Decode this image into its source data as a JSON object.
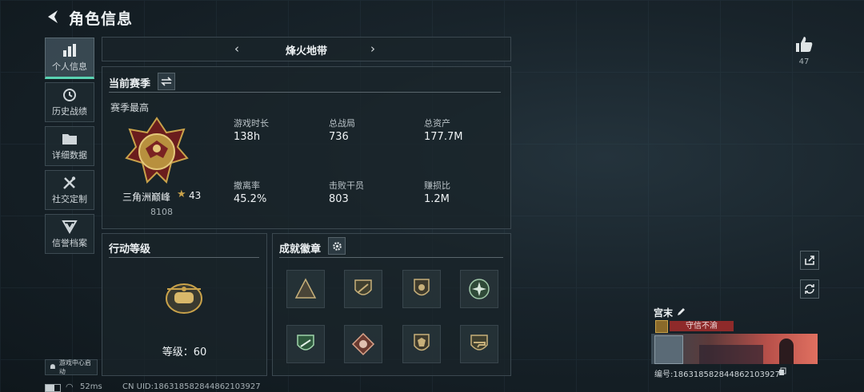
{
  "header": {
    "title": "角色信息"
  },
  "sidebar": {
    "items": [
      {
        "label": "个人信息",
        "icon": "bar-chart-icon",
        "active": true
      },
      {
        "label": "历史战绩",
        "icon": "history-clock-icon",
        "active": false
      },
      {
        "label": "详细数据",
        "icon": "folder-icon",
        "active": false
      },
      {
        "label": "社交定制",
        "icon": "wrench-tools-icon",
        "active": false
      },
      {
        "label": "信誉档案",
        "icon": "reputation-shield-icon",
        "active": false
      }
    ]
  },
  "mode_selector": {
    "label": "烽火地带"
  },
  "season": {
    "header": "当前赛季",
    "subheader": "赛季最高",
    "rank_name": "三角洲巅峰",
    "rank_stars": "43",
    "rank_score": "8108",
    "stats": [
      {
        "label": "游戏时长",
        "value": "138h"
      },
      {
        "label": "总战局",
        "value": "736"
      },
      {
        "label": "总资产",
        "value": "177.7M"
      },
      {
        "label": "撤离率",
        "value": "45.2%"
      },
      {
        "label": "击败干员",
        "value": "803"
      },
      {
        "label": "赚损比",
        "value": "1.2M"
      }
    ]
  },
  "action_level": {
    "header": "行动等级",
    "level_text": "等级：60"
  },
  "achievements": {
    "header": "成就徽章",
    "badge_count": 8
  },
  "likes": {
    "count": "47"
  },
  "profile": {
    "name": "宫末",
    "title_tag": "守信不渝",
    "id_text": "编号:1863185828448621039​27"
  },
  "footer": {
    "game_center": "游戏中心启动",
    "ping": "52ms",
    "uid": "CN UID:18631858284486210392​7"
  },
  "colors": {
    "accent": "#59d3b2",
    "gold": "#c9a24a",
    "tag_red": "#8e2a2a"
  }
}
